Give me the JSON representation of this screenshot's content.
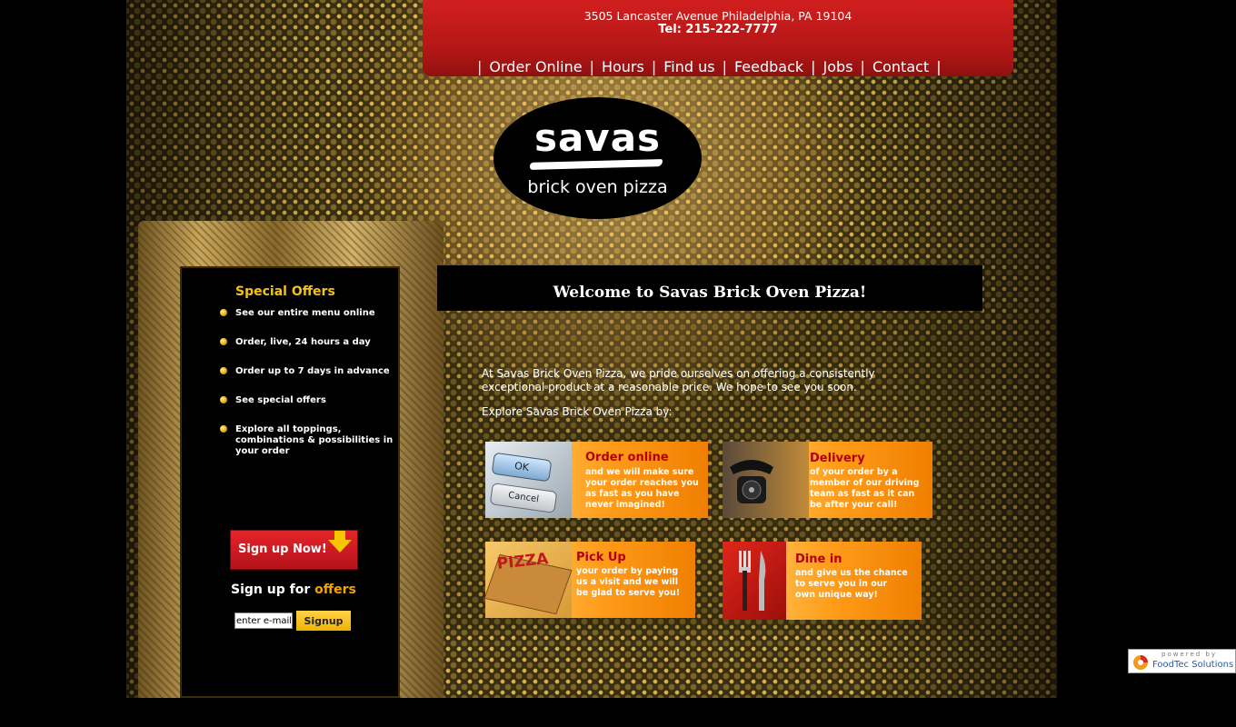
{
  "header": {
    "address": "3505 Lancaster Avenue Philadelphia, PA 19104",
    "phone": "Tel: 215-222-7777",
    "nav": [
      {
        "label": "Order Online"
      },
      {
        "label": "Hours"
      },
      {
        "label": "Find us"
      },
      {
        "label": "Feedback"
      },
      {
        "label": "Jobs"
      },
      {
        "label": "Contact"
      }
    ],
    "separator": "|"
  },
  "logo": {
    "word": "savas",
    "sub": "brick oven pizza"
  },
  "offers": {
    "title": "Special Offers",
    "items": [
      "See our entire menu online",
      "Order, live, 24 hours a day",
      "Order up to 7 days in advance",
      "See special offers",
      "Explore all toppings, combinations & possibilities in your order"
    ]
  },
  "signup": {
    "button_label": "Sign up Now!",
    "heading_prefix": "Sign up for",
    "heading_accent": "offers",
    "email_value": "enter e-mail",
    "submit_label": "Signup"
  },
  "welcome": {
    "title": "Welcome to Savas Brick Oven Pizza!",
    "intro": "At Savas Brick Oven Pizza, we pride ourselves on offering a consistently exceptional product at a reasonable price. We hope to see you soon.",
    "explore": "Explore Savas Brick Oven Pizza by:"
  },
  "tiles": {
    "order": {
      "title": "Order online",
      "desc": "and we will make sure your order reaches you as fast as you have never imagined!",
      "ok": "OK",
      "cancel": "Cancel"
    },
    "delivery": {
      "title": "Delivery",
      "desc": "of your order by a member of our driving team as fast as it can be after your call!"
    },
    "pickup": {
      "title": "Pick Up",
      "desc": "your order by paying us a visit and we will be glad to serve you!",
      "box_text": "PIZZA"
    },
    "dinein": {
      "title": "Dine in",
      "desc": "and give us the chance to serve you in our own unique way!"
    }
  },
  "powered": {
    "by": "powered by",
    "name": "FoodTec Solutions"
  },
  "colors": {
    "header_red": "#c41a1a",
    "offer_gold": "#f2c21b",
    "accent_orange": "#f4a300",
    "tile_title_red": "#b4000a"
  }
}
